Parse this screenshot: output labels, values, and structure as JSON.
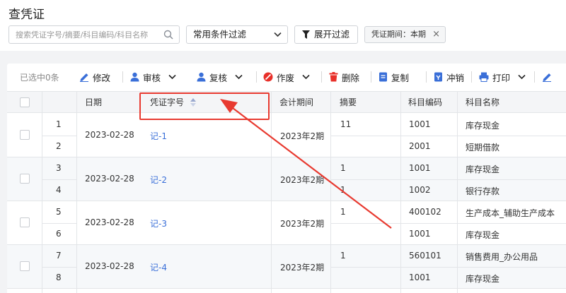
{
  "page_title": "查凭证",
  "search": {
    "placeholder": "搜索凭证字号/摘要/科目编码/科目名称"
  },
  "filter_select": {
    "value": "常用条件过滤"
  },
  "expand_filter_label": "展开过滤",
  "period_tag": {
    "label": "凭证期间：本期"
  },
  "toolbar": {
    "selected_label": "已选中0条",
    "edit": "修改",
    "audit": "审核",
    "review": "复核",
    "void": "作废",
    "delete": "删除",
    "copy": "复制",
    "reverse": "冲销",
    "print": "打印"
  },
  "table": {
    "headers": {
      "date": "日期",
      "voucher_no": "凭证字号",
      "period": "会计期间",
      "summary": "摘要",
      "account_code": "科目编码",
      "account_name": "科目名称"
    },
    "groups": [
      {
        "date": "2023-02-28",
        "voucher": "记-1",
        "period": "2023年2期",
        "rows": [
          {
            "num": "1",
            "summary": "11",
            "code": "1001",
            "name": "库存现金"
          },
          {
            "num": "2",
            "summary": "",
            "code": "2001",
            "name": "短期借款"
          }
        ]
      },
      {
        "date": "2023-02-28",
        "voucher": "记-2",
        "period": "2023年2期",
        "rows": [
          {
            "num": "3",
            "summary": "1",
            "code": "1001",
            "name": "库存现金"
          },
          {
            "num": "4",
            "summary": "1",
            "code": "1002",
            "name": "银行存款"
          }
        ]
      },
      {
        "date": "2023-02-28",
        "voucher": "记-3",
        "period": "2023年2期",
        "rows": [
          {
            "num": "5",
            "summary": "1",
            "code": "400102",
            "name": "生产成本_辅助生产成本"
          },
          {
            "num": "6",
            "summary": "",
            "code": "1001",
            "name": "库存现金"
          }
        ]
      },
      {
        "date": "2023-02-28",
        "voucher": "记-4",
        "period": "2023年2期",
        "rows": [
          {
            "num": "7",
            "summary": "1",
            "code": "560101",
            "name": "销售费用_办公用品"
          },
          {
            "num": "8",
            "summary": "",
            "code": "1001",
            "name": "库存现金"
          }
        ]
      }
    ]
  },
  "colors": {
    "link": "#3a6fd8",
    "toolbar_icon": "#3a6fd8",
    "void_icon": "#e8302a",
    "delete_icon": "#e8302a",
    "annotation": "#e83a30",
    "header_bg": "#f4f5f7",
    "row_alt_bg": "#f6f8fa"
  }
}
